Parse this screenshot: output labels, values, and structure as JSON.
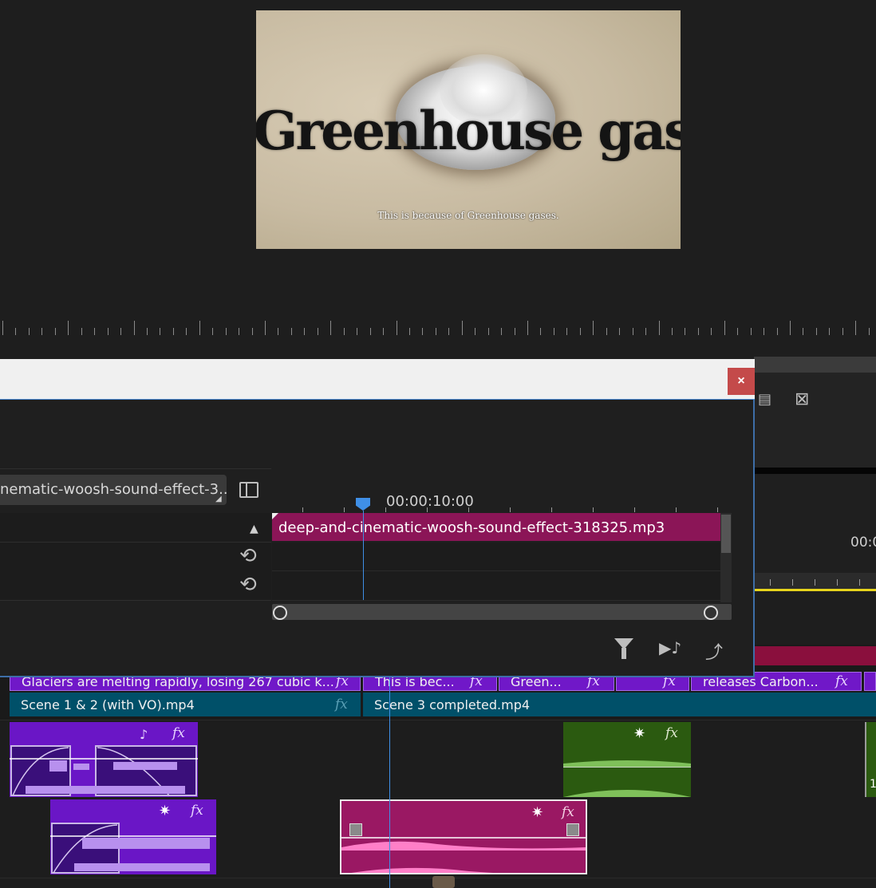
{
  "monitor": {
    "frame_title": "Greenhouse gas",
    "frame_subtitle": "This is because of Greenhouse gases."
  },
  "dialog": {
    "close_label": "×",
    "clip_selector": "nematic-woosh-sound-effect-3...",
    "timecode": "00:00:10:00",
    "clip_name": "deep-and-cinematic-woosh-sound-effect-318325.mp3",
    "icons": [
      "panel-toggle-icon",
      "collapse-arrow-icon",
      "reset-icon",
      "reset-icon",
      "filter-icon",
      "play-audio-icon",
      "export-icon"
    ]
  },
  "timeline": {
    "time_readout": "00:0",
    "captions": [
      {
        "text": "Glaciers are melting rapidly, losing 267 cubic k...",
        "fx": "fx"
      },
      {
        "text": "This is bec...",
        "fx": "fx"
      },
      {
        "text": "Green...",
        "fx": "fx"
      },
      {
        "text": "",
        "fx": "fx"
      },
      {
        "text": "releases Carbon...",
        "fx": "fx"
      }
    ],
    "video_clips": [
      {
        "text": "Scene 1 & 2 (with VO).mp4",
        "fx": "fx"
      },
      {
        "text": "Scene 3 completed.mp4"
      }
    ],
    "audio_fx": "fx",
    "right_clip_digit": "1",
    "colors": {
      "caption": "#7018c8",
      "video": "#005069",
      "audio_purple": "#6a16c6",
      "audio_green": "#2b5a10",
      "audio_pink": "#9a1863",
      "crimson": "#8a0f3d",
      "playhead": "#3f8fe6"
    }
  }
}
